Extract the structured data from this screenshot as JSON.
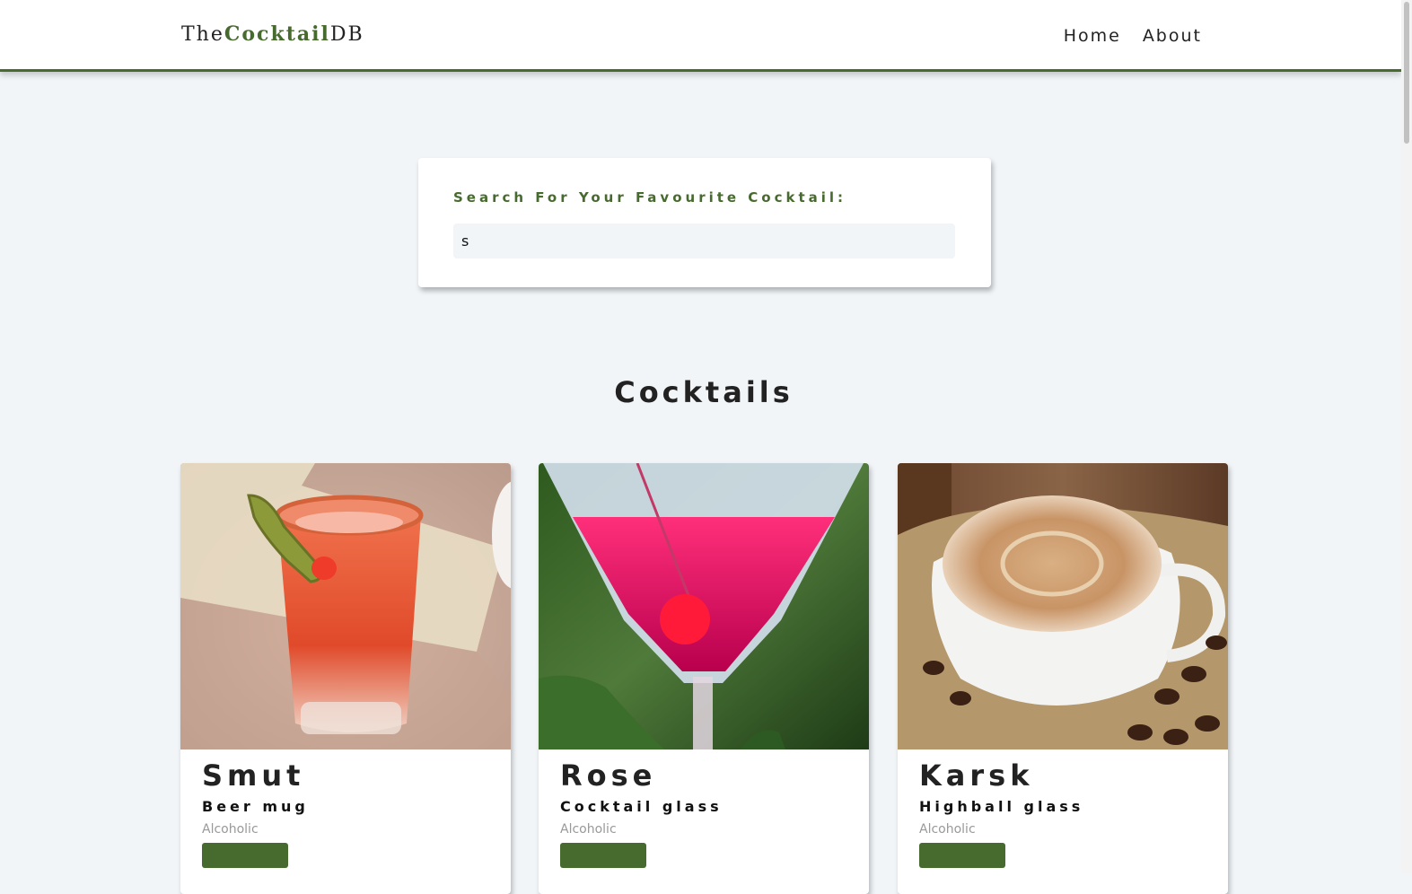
{
  "navbar": {
    "logo_prefix": "The",
    "logo_accent": "Cocktail",
    "logo_suffix": "DB",
    "links": [
      {
        "label": "Home"
      },
      {
        "label": "About"
      }
    ]
  },
  "search": {
    "label": "Search For Your Favourite Cocktail:",
    "value": "s"
  },
  "section": {
    "title": "Cocktails"
  },
  "cocktails": [
    {
      "name": "Smut",
      "glass": "Beer mug",
      "type": "Alcoholic",
      "image": "red-cocktail-with-okra-photo"
    },
    {
      "name": "Rose",
      "glass": "Cocktail glass",
      "type": "Alcoholic",
      "image": "pink-martini-with-cherry-photo"
    },
    {
      "name": "Karsk",
      "glass": "Highball glass",
      "type": "Alcoholic",
      "image": "coffee-cup-with-beans-photo"
    }
  ],
  "colors": {
    "accent": "#476a2e",
    "background": "#f1f5f8",
    "card": "#ffffff",
    "text": "#222222",
    "muted": "#999999"
  }
}
